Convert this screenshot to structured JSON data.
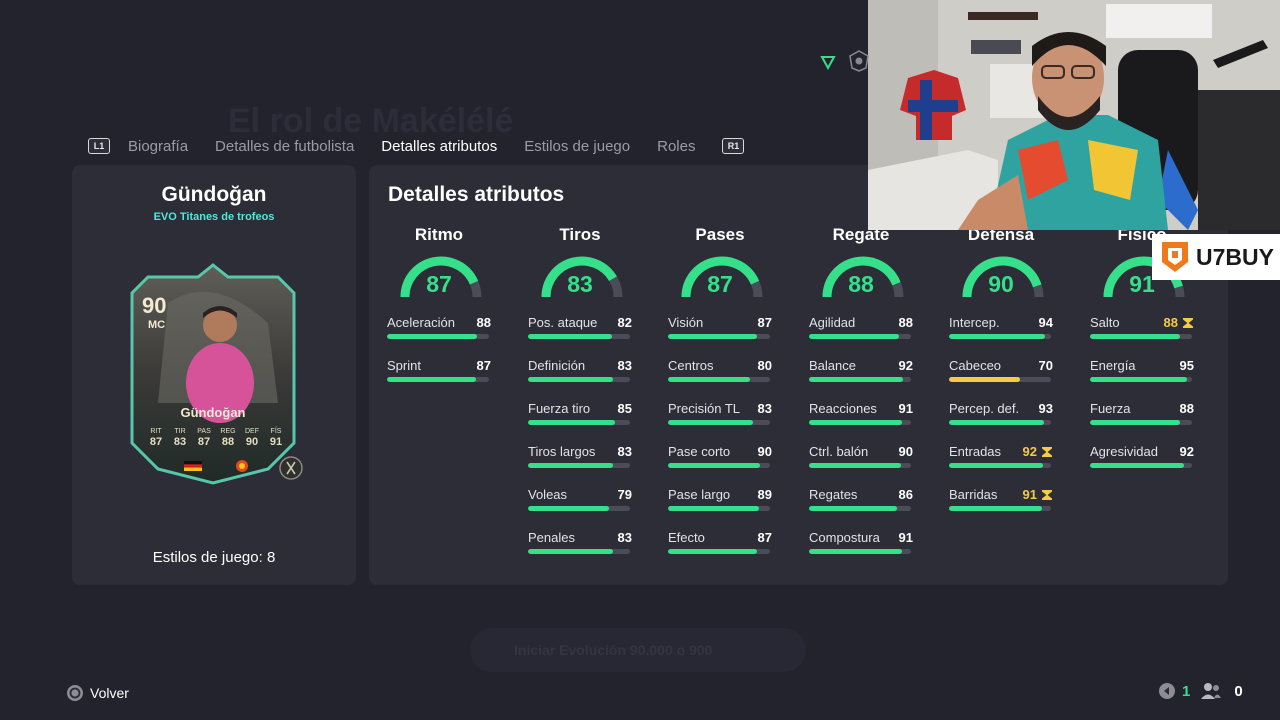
{
  "background": {
    "title": "El rol de Makélélé",
    "strip_text": "Iniciar Evolución  90.000 o  900"
  },
  "tabs": {
    "left_hint": "L1",
    "right_hint": "R1",
    "items": [
      {
        "label": "Biografía",
        "active": false
      },
      {
        "label": "Detalles de futbolista",
        "active": false
      },
      {
        "label": "Detalles atributos",
        "active": true
      },
      {
        "label": "Estilos de juego",
        "active": false
      },
      {
        "label": "Roles",
        "active": false
      }
    ]
  },
  "player": {
    "name": "Gündoğan",
    "version": "EVO Titanes de trofeos",
    "playstyles": "Estilos de juego: 8",
    "card": {
      "rating": "90",
      "position": "MC",
      "name": "Gündoğan",
      "stats": [
        {
          "label": "RIT",
          "value": "87"
        },
        {
          "label": "TIR",
          "value": "83"
        },
        {
          "label": "PAS",
          "value": "87"
        },
        {
          "label": "REG",
          "value": "88"
        },
        {
          "label": "DEF",
          "value": "90"
        },
        {
          "label": "FÍS",
          "value": "91"
        }
      ]
    }
  },
  "attributes": {
    "title": "Detalles atributos",
    "categories": [
      {
        "name": "Ritmo",
        "value": 87,
        "attrs": [
          {
            "label": "Aceleración",
            "value": 88
          },
          {
            "label": "Sprint",
            "value": 87
          }
        ]
      },
      {
        "name": "Tiros",
        "value": 83,
        "attrs": [
          {
            "label": "Pos. ataque",
            "value": 82
          },
          {
            "label": "Definición",
            "value": 83
          },
          {
            "label": "Fuerza tiro",
            "value": 85
          },
          {
            "label": "Tiros largos",
            "value": 83
          },
          {
            "label": "Voleas",
            "value": 79
          },
          {
            "label": "Penales",
            "value": 83
          }
        ]
      },
      {
        "name": "Pases",
        "value": 87,
        "attrs": [
          {
            "label": "Visión",
            "value": 87
          },
          {
            "label": "Centros",
            "value": 80
          },
          {
            "label": "Precisión TL",
            "value": 83
          },
          {
            "label": "Pase corto",
            "value": 90
          },
          {
            "label": "Pase largo",
            "value": 89
          },
          {
            "label": "Efecto",
            "value": 87
          }
        ]
      },
      {
        "name": "Regate",
        "value": 88,
        "attrs": [
          {
            "label": "Agilidad",
            "value": 88
          },
          {
            "label": "Balance",
            "value": 92
          },
          {
            "label": "Reacciones",
            "value": 91
          },
          {
            "label": "Ctrl. balón",
            "value": 90
          },
          {
            "label": "Regates",
            "value": 86
          },
          {
            "label": "Compostura",
            "value": 91
          }
        ]
      },
      {
        "name": "Defensa",
        "value": 90,
        "attrs": [
          {
            "label": "Intercep.",
            "value": 94
          },
          {
            "label": "Cabeceo",
            "value": 70,
            "color": "gold"
          },
          {
            "label": "Percep. def.",
            "value": 93
          },
          {
            "label": "Entradas",
            "value": 92,
            "boosted": true
          },
          {
            "label": "Barridas",
            "value": 91,
            "boosted": true
          }
        ]
      },
      {
        "name": "Físico",
        "value": 91,
        "attrs": [
          {
            "label": "Salto",
            "value": 88,
            "boosted": true
          },
          {
            "label": "Energía",
            "value": 95
          },
          {
            "label": "Fuerza",
            "value": 88
          },
          {
            "label": "Agresividad",
            "value": 92
          }
        ]
      }
    ]
  },
  "overlay": {
    "brand": "U7BUY"
  },
  "footer": {
    "back_label": "Volver",
    "count_a": "1",
    "count_b": "0"
  },
  "colors": {
    "accent_green": "#36e08a",
    "boost_gold": "#f7c948",
    "version_cyan": "#4fe8d9",
    "panel": "#2c2d37",
    "background": "#22232d"
  }
}
